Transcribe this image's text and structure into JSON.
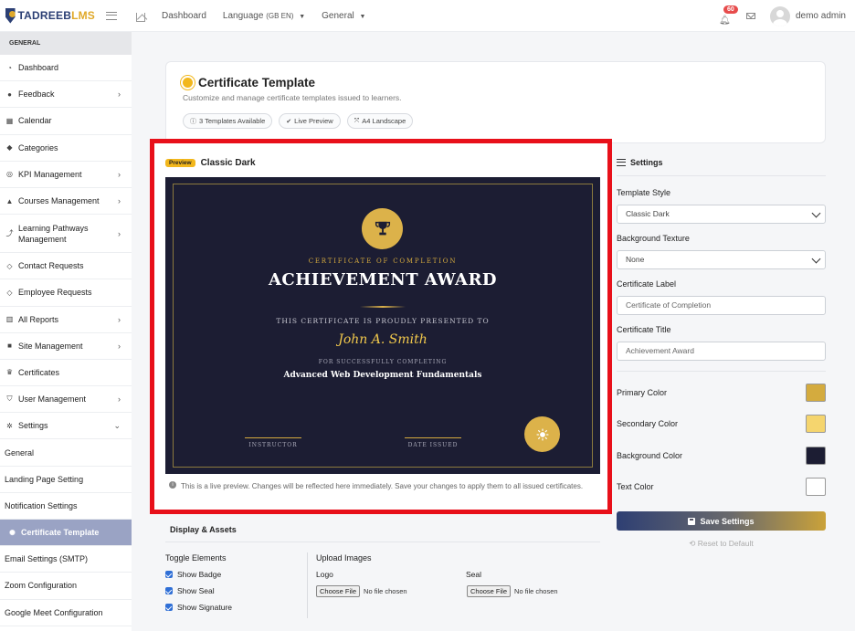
{
  "app": {
    "logo_main": "TADREEB",
    "logo_accent": "LMS"
  },
  "topnav": {
    "dashboard": "Dashboard",
    "language": "Language",
    "language_code": "(GB EN)",
    "general": "General",
    "notifications_count": "60",
    "user_name": "demo admin"
  },
  "sidebar": {
    "header": "GENERAL",
    "items": [
      {
        "label": "Dashboard",
        "icon": "gauge-icon",
        "glyph": "◔"
      },
      {
        "label": "Feedback",
        "icon": "chat-icon",
        "glyph": "●"
      },
      {
        "label": "Calendar",
        "icon": "calendar-icon",
        "glyph": "▦"
      },
      {
        "label": "Categories",
        "icon": "tag-icon",
        "glyph": "◆"
      },
      {
        "label": "KPI Management",
        "icon": "target-icon",
        "glyph": "◎"
      },
      {
        "label": "Courses Management",
        "icon": "graduation-cap-icon",
        "glyph": "▲"
      },
      {
        "label_line1": "Learning Pathways",
        "label_line2": "Management",
        "icon": "route-icon",
        "glyph": "⤴"
      },
      {
        "label": "Contact Requests",
        "icon": "tag-outline-icon",
        "glyph": "◇"
      },
      {
        "label": "Employee Requests",
        "icon": "tag-outline-icon",
        "glyph": "◇"
      },
      {
        "label": "All Reports",
        "icon": "bar-chart-icon",
        "glyph": "▥"
      },
      {
        "label": "Site Management",
        "icon": "folder-icon",
        "glyph": "■"
      },
      {
        "label": "Certificates",
        "icon": "trophy-icon",
        "glyph": "♛"
      },
      {
        "label": "User Management",
        "icon": "shield-icon",
        "glyph": "⛉"
      },
      {
        "label": "Settings",
        "icon": "gear-icon",
        "glyph": "✲"
      },
      {
        "label": "General"
      },
      {
        "label": "Landing Page Setting"
      },
      {
        "label": "Notification Settings"
      },
      {
        "label": "Certificate Template",
        "glyph": "✺"
      },
      {
        "label": "Email Settings (SMTP)"
      },
      {
        "label": "Zoom Configuration"
      },
      {
        "label": "Google Meet Configuration"
      }
    ]
  },
  "hero": {
    "title": "Certificate Template",
    "subtitle": "Customize and manage certificate templates issued to learners.",
    "pills": [
      {
        "icon": "info-icon",
        "glyph": "ⓘ",
        "label": "3  Templates Available"
      },
      {
        "icon": "check-circle-icon",
        "glyph": "✔",
        "label": "Live Preview"
      },
      {
        "icon": "expand-icon",
        "glyph": "⤧",
        "label": "A4 Landscape"
      }
    ]
  },
  "preview": {
    "badge": "Preview",
    "name": "Classic Dark",
    "note": "This is a live preview. Changes will be reflected here immediately. Save your changes to apply them to all issued certificates."
  },
  "certificate": {
    "label": "CERTIFICATE OF COMPLETION",
    "title": "ACHIEVEMENT AWARD",
    "presented": "THIS CERTIFICATE IS PROUDLY PRESENTED TO",
    "recipient": "John A. Smith",
    "completing": "FOR SUCCESSFULLY COMPLETING",
    "course": "Advanced Web Development Fundamentals",
    "signature_left": "INSTRUCTOR",
    "signature_right": "DATE ISSUED"
  },
  "display_assets": {
    "title": "Display & Assets",
    "toggle_title": "Toggle Elements",
    "toggles": [
      "Show Badge",
      "Show Seal",
      "Show Signature"
    ],
    "upload_title": "Upload Images",
    "logo_label": "Logo",
    "seal_label": "Seal",
    "choose_file": "Choose File",
    "no_file": "No file chosen"
  },
  "settings": {
    "title": "Settings",
    "template_style_label": "Template Style",
    "template_style_value": "Classic Dark",
    "texture_label": "Background Texture",
    "texture_value": "None",
    "cert_label_label": "Certificate Label",
    "cert_label_value": "Certificate of Completion",
    "cert_title_label": "Certificate Title",
    "cert_title_value": "Achievement Award",
    "colors": [
      {
        "label": "Primary Color",
        "value": "#d4ab3e"
      },
      {
        "label": "Secondary Color",
        "value": "#f5d56e"
      },
      {
        "label": "Background Color",
        "value": "#1c1d33"
      },
      {
        "label": "Text Color",
        "value": "#ffffff"
      }
    ],
    "save_label": "Save Settings",
    "reset_label": "Reset to Default"
  }
}
